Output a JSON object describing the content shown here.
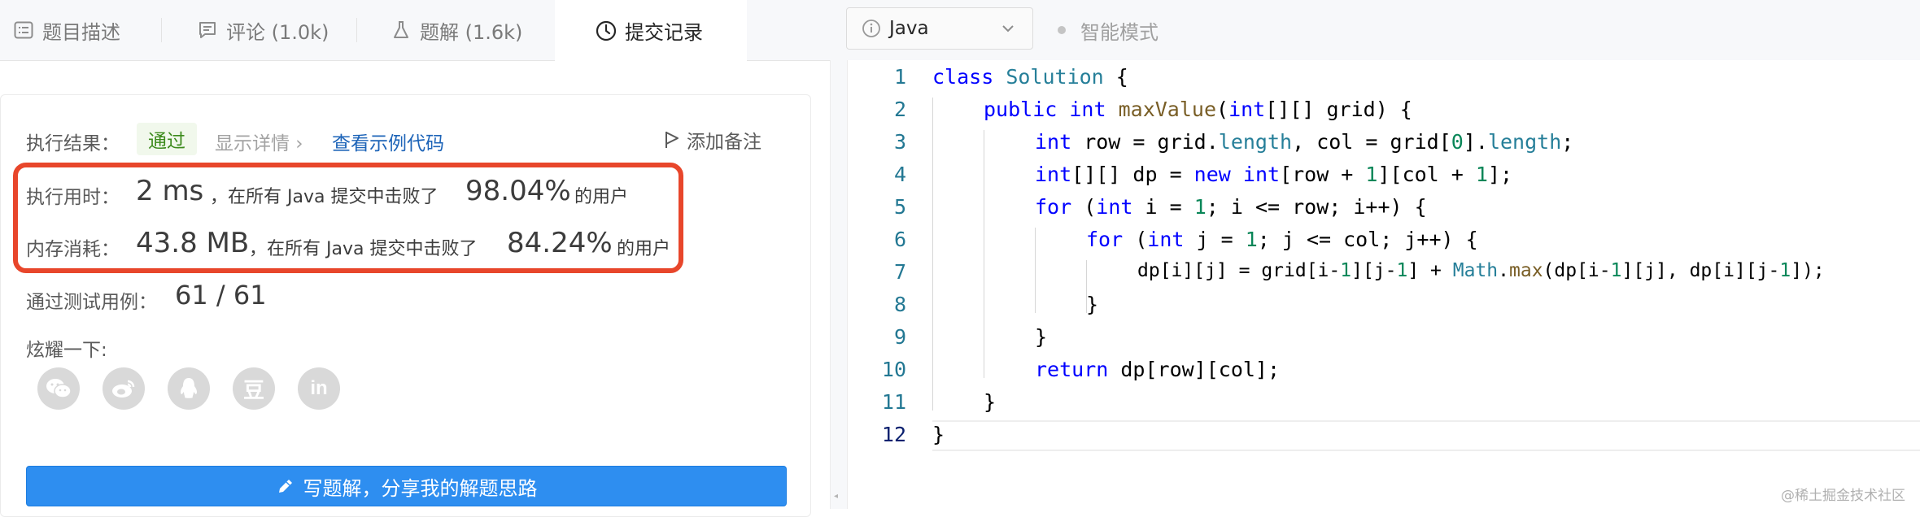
{
  "tabs": [
    {
      "label": "题目描述",
      "icon": "description-icon"
    },
    {
      "label": "评论 (1.0k)",
      "icon": "comment-icon"
    },
    {
      "label": "题解 (1.6k)",
      "icon": "flask-icon"
    },
    {
      "label": "提交记录",
      "icon": "clock-icon",
      "active": true
    }
  ],
  "editor_toolbar": {
    "language": "Java",
    "mode_label": "智能模式"
  },
  "result": {
    "label": "执行结果：",
    "status": "通过",
    "details_link": "显示详情 ›",
    "sample_link": "查看示例代码",
    "add_note": "添加备注"
  },
  "runtime": {
    "label": "执行用时：",
    "value": "2 ms",
    "text_before": "，在所有 Java 提交中击败了",
    "percent": "98.04%",
    "text_after": "的用户"
  },
  "memory": {
    "label": "内存消耗：",
    "value": "43.8 MB",
    "text_before": "，在所有 Java 提交中击败了",
    "percent": "84.24%",
    "text_after": "的用户"
  },
  "tests": {
    "label": "通过测试用例：",
    "value": "61 / 61"
  },
  "share": {
    "label": "炫耀一下:",
    "icons": [
      "wechat-icon",
      "weibo-icon",
      "qq-icon",
      "douban-icon",
      "linkedin-icon"
    ],
    "douban_glyph": "豆",
    "linkedin_glyph": "in"
  },
  "solution_button": "写题解，分享我的解题思路",
  "code": {
    "line_numbers": [
      "1",
      "2",
      "3",
      "4",
      "5",
      "6",
      "7",
      "8",
      "9",
      "10",
      "11",
      "12"
    ],
    "l1_class": "class",
    "l1_name": "Solution",
    "l1_brace": " {",
    "l2_public": "public",
    "l2_int": "int",
    "l2_method": "maxValue",
    "l2_paren": "(",
    "l2_int2": "int",
    "l2_rest": "[][] grid) {",
    "l3_int": "int",
    "l3_row": " row = grid.",
    "l3_length": "length",
    "l3_col": ", col = grid[",
    "l3_zero": "0",
    "l3_close": "].",
    "l3_length2": "length",
    "l3_semi": ";",
    "l4_int": "int",
    "l4_dp": "[][] dp = ",
    "l4_new": "new",
    "l4_sp": " ",
    "l4_int2": "int",
    "l4_a": "[row + ",
    "l4_one": "1",
    "l4_b": "][col + ",
    "l4_one2": "1",
    "l4_c": "];",
    "l5_for": "for",
    "l5_a": " (",
    "l5_int": "int",
    "l5_b": " i = ",
    "l5_one": "1",
    "l5_c": "; i <= row; i++) {",
    "l6_for": "for",
    "l6_a": " (",
    "l6_int": "int",
    "l6_b": " j = ",
    "l6_one": "1",
    "l6_c": "; j <= col; j++) {",
    "l7_a": "dp[i][j] = grid[i-",
    "l7_one": "1",
    "l7_b": "][j-",
    "l7_one2": "1",
    "l7_c": "] + ",
    "l7_math": "Math",
    "l7_dot": ".",
    "l7_max": "max",
    "l7_d": "(dp[i-",
    "l7_one3": "1",
    "l7_e": "][j], dp[i][j-",
    "l7_one4": "1",
    "l7_f": "]);",
    "l8": "}",
    "l9": "}",
    "l10_return": "return",
    "l10_rest": " dp[row][col];",
    "l11": "}",
    "l12": "}"
  },
  "watermark": "@稀土掘金技术社区",
  "colors": {
    "accent_blue": "#2e8ef0",
    "highlight_red": "#e8462b",
    "pass_green_bg": "#f1f8ec",
    "pass_green_text": "#3c8a1c",
    "link_blue": "#1d64b8"
  }
}
